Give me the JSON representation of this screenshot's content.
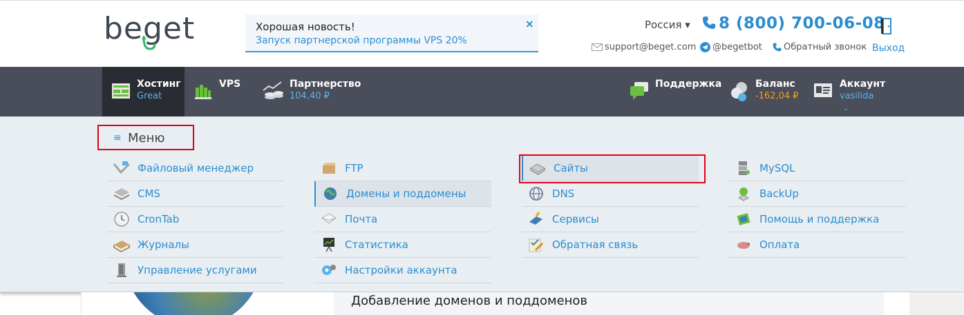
{
  "header": {
    "logo_text": "beget",
    "news": {
      "title": "Хорошая новость!",
      "link": "Запуск партнерской программы VPS 20%",
      "close": "×"
    },
    "region": "Россия ▾",
    "phone": "8 (800) 700-06-08",
    "email": "support@beget.com",
    "telegram": "@begetbot",
    "callback": "Обратный звонок",
    "logout": "Выход"
  },
  "nav": {
    "hosting": {
      "title": "Хостинг",
      "sub": "Great"
    },
    "vps": {
      "title": "VPS"
    },
    "partner": {
      "title": "Партнерство",
      "sub": "104,40 ₽"
    },
    "support": {
      "title": "Поддержка"
    },
    "balance": {
      "title": "Баланс",
      "sub": "-162,04 ₽"
    },
    "account": {
      "title": "Аккаунт",
      "sub": "vasilida",
      "chevron": "⌄"
    }
  },
  "menu": {
    "hamburger": "≡",
    "label": "Меню",
    "columns": [
      [
        {
          "label": "Файловый менеджер",
          "icon": "file-manager-icon"
        },
        {
          "label": "CMS",
          "icon": "cms-icon"
        },
        {
          "label": "CronTab",
          "icon": "clock-icon"
        },
        {
          "label": "Журналы",
          "icon": "logs-icon"
        },
        {
          "label": "Управление услугами",
          "icon": "services-management-icon"
        }
      ],
      [
        {
          "label": "FTP",
          "icon": "ftp-icon"
        },
        {
          "label": "Домены и поддомены",
          "icon": "domains-icon"
        },
        {
          "label": "Почта",
          "icon": "mail-icon"
        },
        {
          "label": "Статистика",
          "icon": "statistics-icon"
        },
        {
          "label": "Настройки аккаунта",
          "icon": "account-settings-icon"
        }
      ],
      [
        {
          "label": "Сайты",
          "icon": "sites-icon"
        },
        {
          "label": "DNS",
          "icon": "dns-icon"
        },
        {
          "label": "Сервисы",
          "icon": "services-icon"
        },
        {
          "label": "Обратная связь",
          "icon": "feedback-icon"
        }
      ],
      [
        {
          "label": "MySQL",
          "icon": "mysql-icon"
        },
        {
          "label": "BackUp",
          "icon": "backup-icon"
        },
        {
          "label": "Помощь и поддержка",
          "icon": "help-icon"
        },
        {
          "label": "Оплата",
          "icon": "payment-icon"
        }
      ]
    ]
  },
  "page": {
    "section_title": "Добавление доменов и поддоменов"
  },
  "colors": {
    "accent": "#2b8dd0",
    "nav_bg": "#4a4d5a",
    "nav_active": "#2a2c33",
    "menu_bg": "#e9eef2",
    "highlight": "#e0001a",
    "negative": "#f2a020"
  }
}
